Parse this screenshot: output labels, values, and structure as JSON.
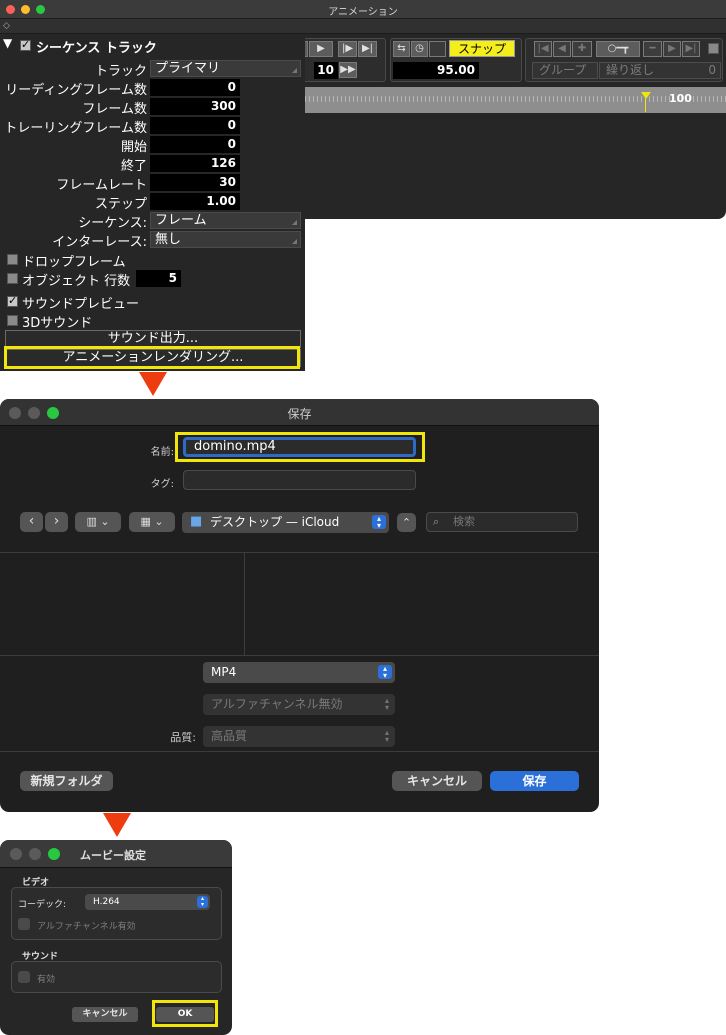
{
  "anim": {
    "title": "アニメーション",
    "sub_icon": "◇",
    "sequence_track": "シーケンス トラック",
    "track_label": "トラック",
    "track_value": "プライマリ",
    "fields": [
      {
        "label": "リーディングフレーム数",
        "value": "0"
      },
      {
        "label": "フレーム数",
        "value": "300"
      },
      {
        "label": "トレーリングフレーム数",
        "value": "0"
      },
      {
        "label": "開始",
        "value": "0"
      },
      {
        "label": "終了",
        "value": "126"
      },
      {
        "label": "フレームレート",
        "value": "30"
      },
      {
        "label": "ステップ",
        "value": "1.00"
      }
    ],
    "sequence_label": "シーケンス:",
    "sequence_value": "フレーム",
    "interlace_label": "インターレース:",
    "interlace_value": "無し",
    "drop_frame": "ドロップフレーム",
    "object_rows": "オブジェクト 行数",
    "object_rows_value": "5",
    "sound_preview": "サウンドプレビュー",
    "sound_3d": "3Dサウンド",
    "sound_output": "サウンド出力...",
    "anim_render": "アニメーションレンダリング...",
    "frame_step": "10",
    "current_value": "95.00",
    "snap": "スナップ",
    "group": "グループ",
    "repeat": "繰り返し",
    "repeat_value": "0",
    "ruler_label": "100"
  },
  "save": {
    "title": "保存",
    "name_label": "名前:",
    "name_value": "domino.mp4",
    "tag_label": "タグ:",
    "location": "デスクトップ — iCloud",
    "search_placeholder": "検索",
    "format": "MP4",
    "alpha": "アルファチャンネル無効",
    "quality_label": "品質:",
    "quality": "高品質",
    "new_folder": "新規フォルダ",
    "cancel": "キャンセル",
    "save": "保存"
  },
  "movie": {
    "title": "ムービー設定",
    "video_section": "ビデオ",
    "codec_label": "コーデック:",
    "codec_value": "H.264",
    "alpha_enabled": "アルファチャンネル有効",
    "sound_section": "サウンド",
    "sound_enabled": "有効",
    "cancel": "キャンセル",
    "ok": "OK"
  },
  "colors": {
    "highlight": "#f0e60a",
    "arrow": "#ec3c10",
    "snap": "#f4ee1c",
    "blue_button": "#2b6fd8"
  }
}
